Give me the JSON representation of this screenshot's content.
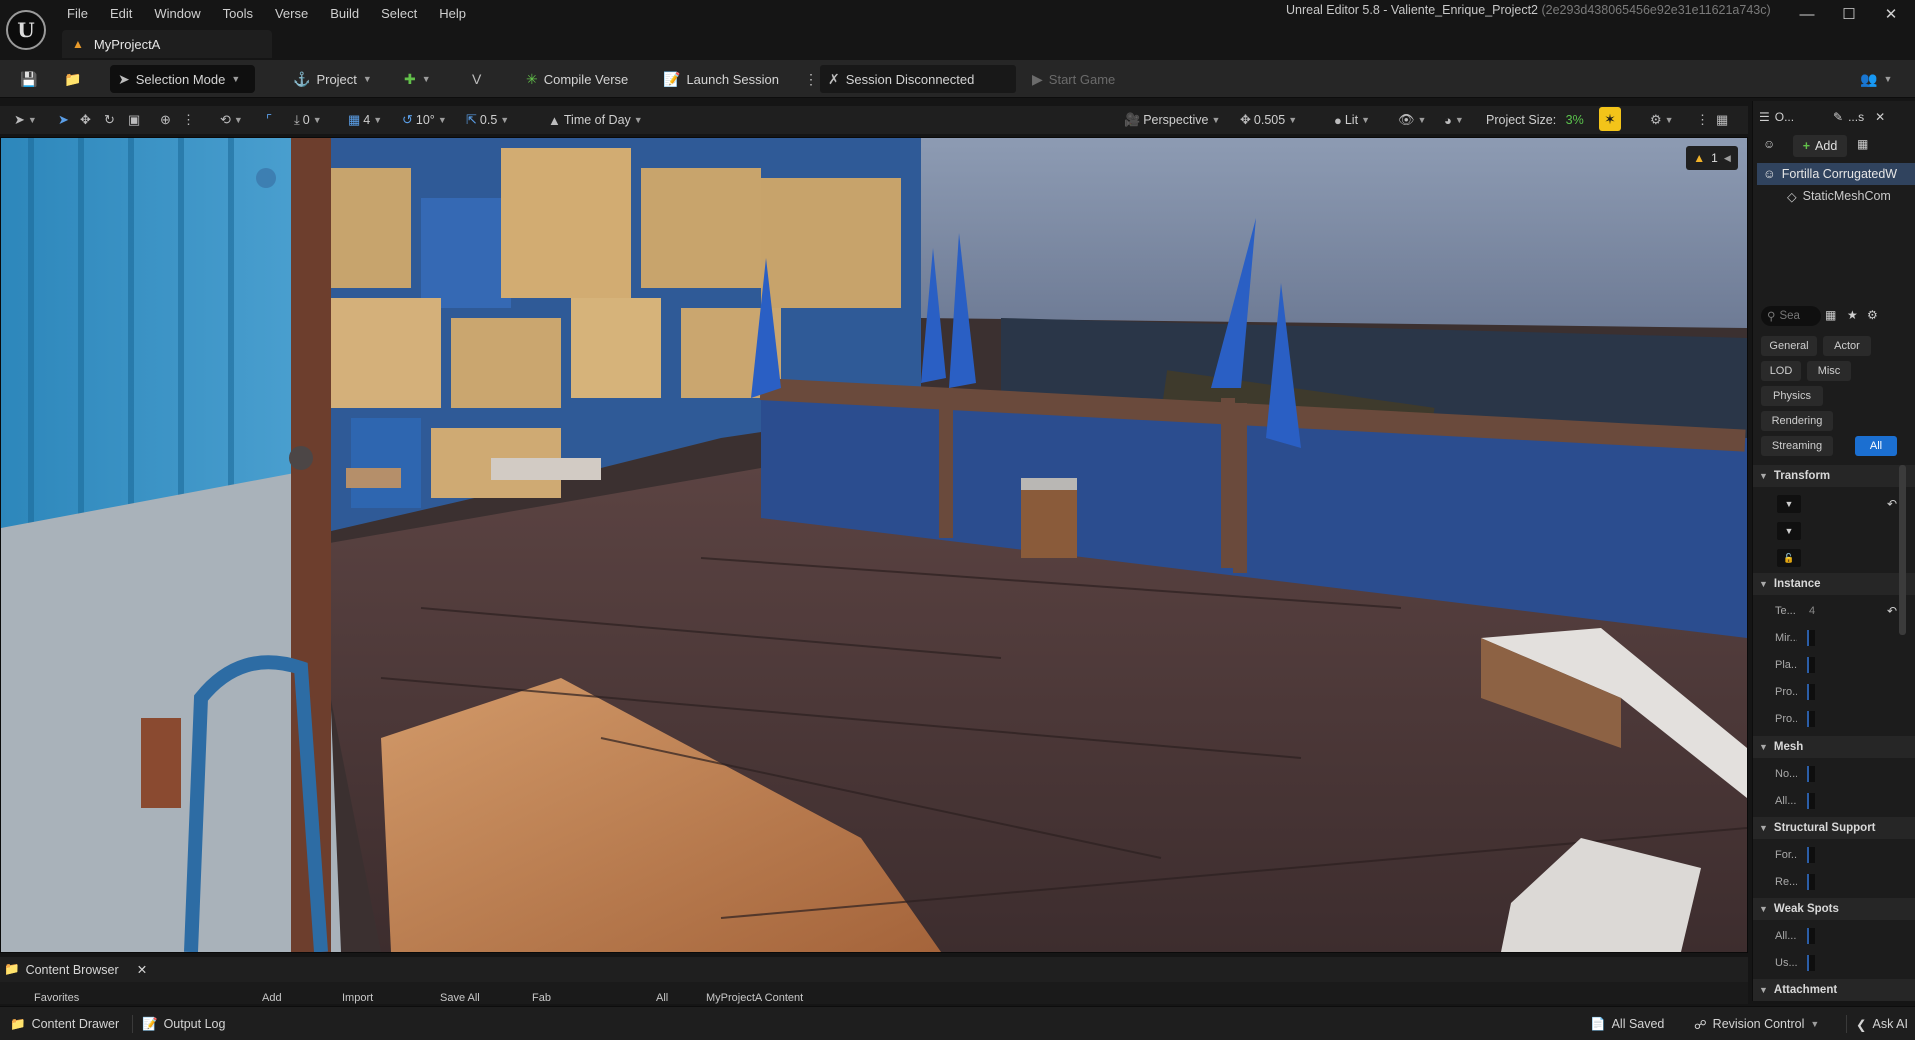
{
  "app": {
    "window_title": "Unreal Editor 5.8 - Valiente_Enrique_Project2",
    "window_hash": "(2e293d438065456e92e31e11621a743c)",
    "project_tab": "MyProjectA"
  },
  "menu": [
    "File",
    "Edit",
    "Window",
    "Tools",
    "Verse",
    "Build",
    "Select",
    "Help"
  ],
  "toolbar": {
    "selection_mode": "Selection Mode",
    "project": "Project",
    "compile_verse": "Compile Verse",
    "launch_session": "Launch Session",
    "session_status": "Session Disconnected",
    "start_game": "Start Game"
  },
  "viewport_toolbar": {
    "rotation_snap": "0",
    "grid_snap": "4",
    "angle_snap": "10°",
    "scale_snap": "0.5",
    "time_of_day": "Time of Day",
    "perspective": "Perspective",
    "camera_speed": "0.505",
    "view_mode": "Lit",
    "project_size_label": "Project Size:",
    "project_size_value": "3%",
    "warning_count": "1"
  },
  "outliner": {
    "tab_label": "O...",
    "details_tab_label": "...s",
    "add_label": "Add",
    "components": [
      "Fortilla CorrugatedW",
      "StaticMeshCom"
    ]
  },
  "details": {
    "search_placeholder": "Sea",
    "filters": [
      "General",
      "Actor",
      "LOD",
      "Misc",
      "Physics",
      "Rendering",
      "Streaming",
      "All"
    ],
    "categories": {
      "transform": "Transform",
      "instance": "Instance",
      "mesh": "Mesh",
      "structural": "Structural Support",
      "weak_spots": "Weak Spots",
      "attachment": "Attachment"
    },
    "instance_rows": [
      "Te...",
      "Mir...",
      "Pla...",
      "Pro...",
      "Pro..."
    ],
    "mesh_rows": [
      "No...",
      "All..."
    ],
    "structural_rows": [
      "For...",
      "Re..."
    ],
    "weak_rows": [
      "All...",
      "Us..."
    ],
    "instance_value": "4"
  },
  "bottom": {
    "content_browser": "Content Browser",
    "strip": [
      "Favorites",
      "Add",
      "Import",
      "Save All",
      "Fab",
      "All",
      "MyProjectA Content"
    ]
  },
  "statusbar": {
    "content_drawer": "Content Drawer",
    "output_log": "Output Log",
    "all_saved": "All Saved",
    "revision_control": "Revision Control",
    "ask_ai": "Ask AI"
  }
}
